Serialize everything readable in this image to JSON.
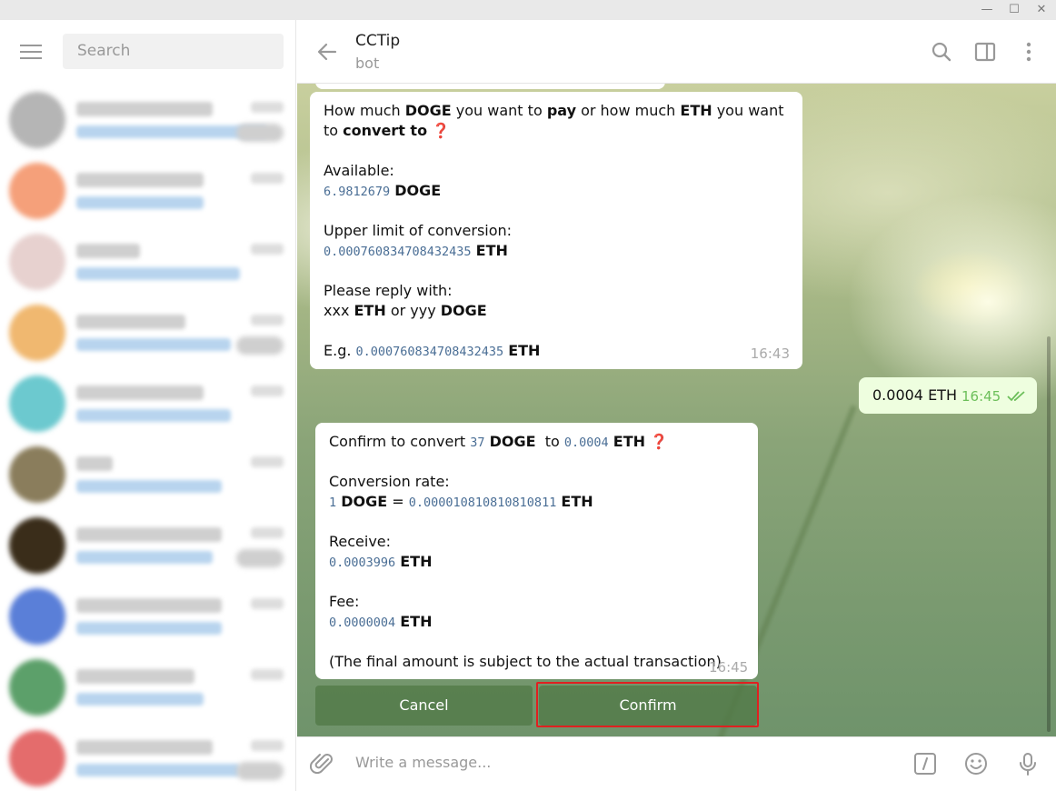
{
  "window": {
    "minimize": "—",
    "maximize": "☐",
    "close": "✕"
  },
  "sidebar": {
    "search_placeholder": "Search",
    "chats": [
      {
        "color": "#b5b5b5"
      },
      {
        "color": "#f5a07a"
      },
      {
        "color": "#e7d1cf"
      },
      {
        "color": "#f0b870"
      },
      {
        "color": "#6cc9cf"
      },
      {
        "color": "#8a7d5c"
      },
      {
        "color": "#3a2d1a"
      },
      {
        "color": "#5a7fd8"
      },
      {
        "color": "#5ca06a"
      },
      {
        "color": "#e46c6c"
      }
    ]
  },
  "header": {
    "title": "CCTip",
    "subtitle": "bot"
  },
  "messages": {
    "msg1": {
      "time": "16:43",
      "q_prefix": "How much ",
      "q_doge": "DOGE",
      "q_mid1": " you want to ",
      "q_pay": "pay",
      "q_mid2": " or how much ",
      "q_eth": "ETH",
      "q_mid3": " you want",
      "q_to": "to ",
      "q_convert": "convert to",
      "q_mark": " ❓",
      "available_label": "Available:",
      "available_value": "6.9812679",
      "available_unit": "DOGE",
      "limit_label": "Upper limit of conversion:",
      "limit_value": "0.000760834708432435",
      "limit_unit": "ETH",
      "reply_label": "Please reply with:",
      "reply_xxx": "xxx ",
      "reply_eth": "ETH",
      "reply_or": " or yyy ",
      "reply_doge": "DOGE",
      "eg_label": "E.g. ",
      "eg_value": "0.000760834708432435",
      "eg_unit": "ETH"
    },
    "outgoing": {
      "text": "0.0004 ETH",
      "time": "16:45",
      "status_icon": "double-check"
    },
    "msg2": {
      "time": "16:45",
      "confirm_prefix": "Confirm to convert ",
      "confirm_amount": "37",
      "confirm_doge": "DOGE",
      "confirm_to": "to ",
      "confirm_eth_amount": "0.0004",
      "confirm_eth": "ETH",
      "confirm_mark": " ❓",
      "rate_label": "Conversion rate:",
      "rate_one": "1",
      "rate_doge": "DOGE",
      "rate_eq": " = ",
      "rate_value": "0.000010810810810811",
      "rate_eth": "ETH",
      "receive_label": "Receive:",
      "receive_value": "0.0003996",
      "receive_unit": "ETH",
      "fee_label": "Fee:",
      "fee_value": "0.0000004",
      "fee_unit": "ETH",
      "note": "(The final amount is subject to the actual transaction)"
    }
  },
  "keyboard": {
    "cancel": "Cancel",
    "confirm": "Confirm"
  },
  "composer": {
    "placeholder": "Write a message..."
  },
  "colors": {
    "accent": "#5a8a5a",
    "highlight_border": "#e02020",
    "code_text": "#4a6e95"
  }
}
